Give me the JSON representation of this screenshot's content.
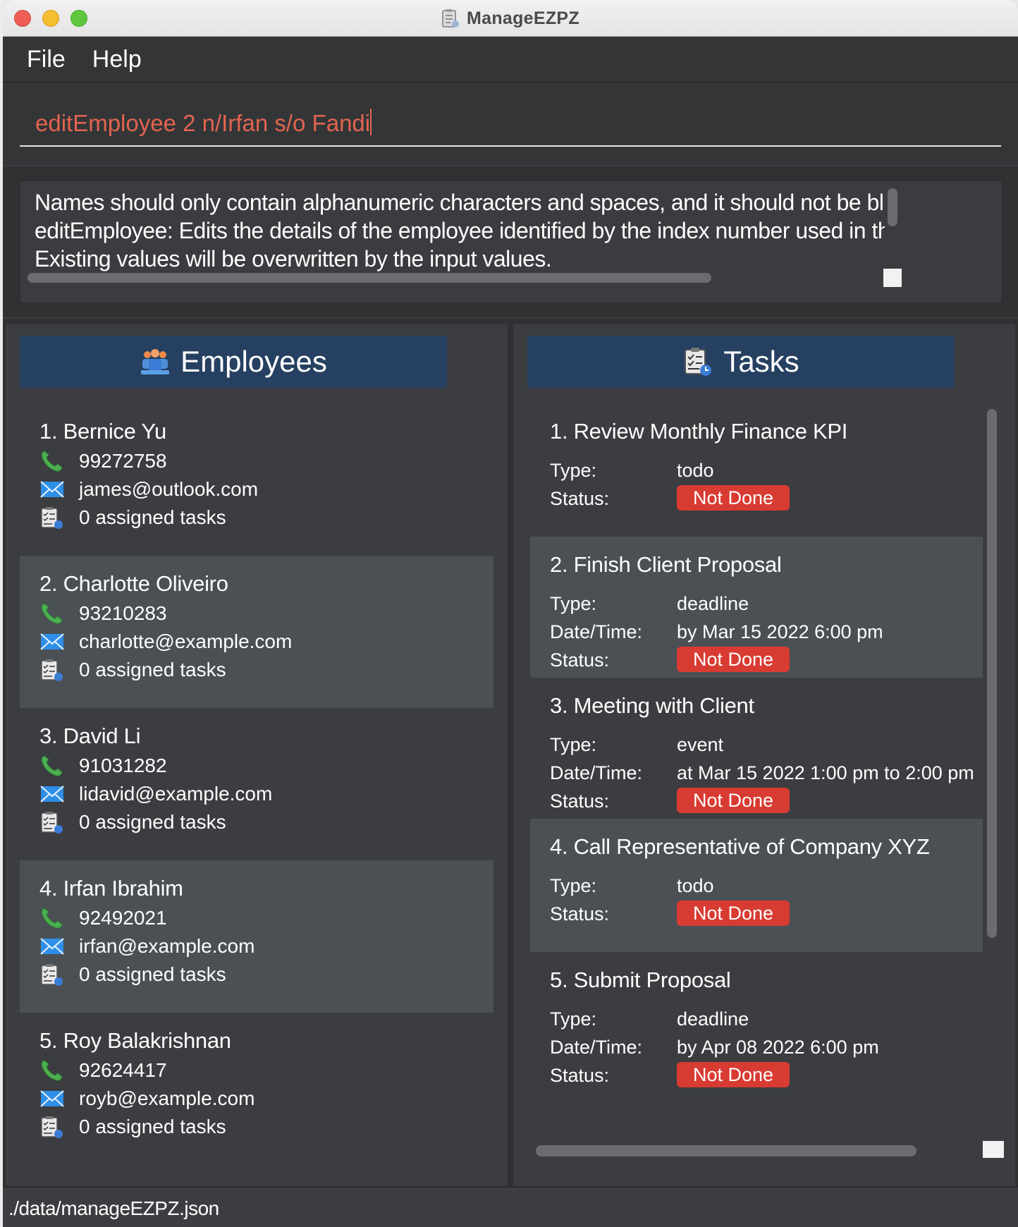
{
  "window": {
    "title": "ManageEZPZ"
  },
  "menu": {
    "file": "File",
    "help": "Help"
  },
  "command": {
    "value": "editEmployee 2 n/Irfan s/o Fandi"
  },
  "result": {
    "lines": [
      "Names should only contain alphanumeric characters and spaces, and it should not be blank",
      "editEmployee: Edits the details of the employee identified by the index number used in the displayed employee list.",
      "Existing values will be overwritten by the input values."
    ]
  },
  "employees_panel": {
    "title": "Employees",
    "items": [
      {
        "index": "1.",
        "name": "Bernice Yu",
        "phone": "99272758",
        "email": "james@outlook.com",
        "tasks": "0 assigned tasks"
      },
      {
        "index": "2.",
        "name": "Charlotte Oliveiro",
        "phone": "93210283",
        "email": "charlotte@example.com",
        "tasks": "0 assigned tasks"
      },
      {
        "index": "3.",
        "name": "David Li",
        "phone": "91031282",
        "email": "lidavid@example.com",
        "tasks": "0 assigned tasks"
      },
      {
        "index": "4.",
        "name": "Irfan Ibrahim",
        "phone": "92492021",
        "email": "irfan@example.com",
        "tasks": "0 assigned tasks"
      },
      {
        "index": "5.",
        "name": "Roy Balakrishnan",
        "phone": "92624417",
        "email": "royb@example.com",
        "tasks": "0 assigned tasks"
      }
    ]
  },
  "tasks_panel": {
    "title": "Tasks",
    "labels": {
      "type": "Type:",
      "datetime": "Date/Time:",
      "status": "Status:"
    },
    "items": [
      {
        "index": "1.",
        "title": "Review Monthly Finance KPI",
        "type": "todo",
        "datetime": "",
        "status": "Not Done"
      },
      {
        "index": "2.",
        "title": "Finish Client Proposal",
        "type": "deadline",
        "datetime": "by Mar 15 2022 6:00 pm",
        "status": "Not Done"
      },
      {
        "index": "3.",
        "title": "Meeting with Client",
        "type": "event",
        "datetime": "at Mar 15 2022 1:00 pm to 2:00 pm",
        "status": "Not Done"
      },
      {
        "index": "4.",
        "title": "Call Representative of Company XYZ",
        "type": "todo",
        "datetime": "",
        "status": "Not Done"
      },
      {
        "index": "5.",
        "title": "Submit Proposal",
        "type": "deadline",
        "datetime": "by Apr 08 2022 6:00 pm",
        "status": "Not Done"
      }
    ]
  },
  "statusbar": {
    "path": "./data/manageEZPZ.json"
  },
  "colors": {
    "header_blue": "#264061",
    "badge_red": "#d83b32",
    "command_text": "#e3644f"
  },
  "icons": {
    "phone": "phone-icon",
    "email": "email-icon",
    "tasks": "task-list-icon",
    "employees": "employees-icon"
  }
}
